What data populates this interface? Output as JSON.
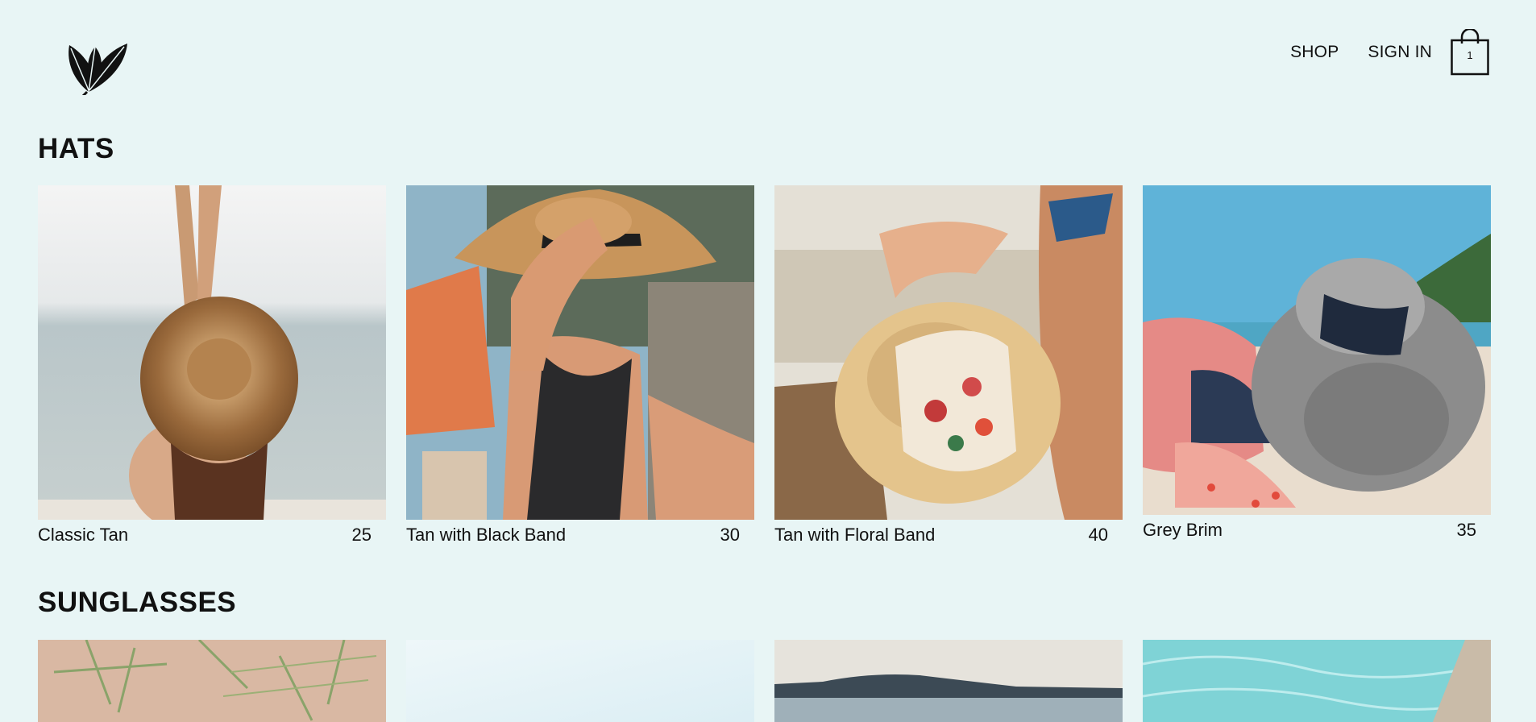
{
  "header": {
    "logo_icon": "palm-leaves-icon",
    "nav": {
      "shop_label": "SHOP",
      "sign_in_label": "SIGN IN"
    },
    "cart": {
      "icon": "shopping-bag-icon",
      "count": "1"
    }
  },
  "sections": [
    {
      "title": "HATS",
      "items": [
        {
          "name": "Classic Tan",
          "price": "25"
        },
        {
          "name": "Tan with Black Band",
          "price": "30"
        },
        {
          "name": "Tan with Floral Band",
          "price": "40"
        },
        {
          "name": "Grey Brim",
          "price": "35"
        }
      ]
    },
    {
      "title": "SUNGLASSES",
      "items": []
    }
  ],
  "colors": {
    "background": "#e8f5f5",
    "text": "#111111"
  }
}
